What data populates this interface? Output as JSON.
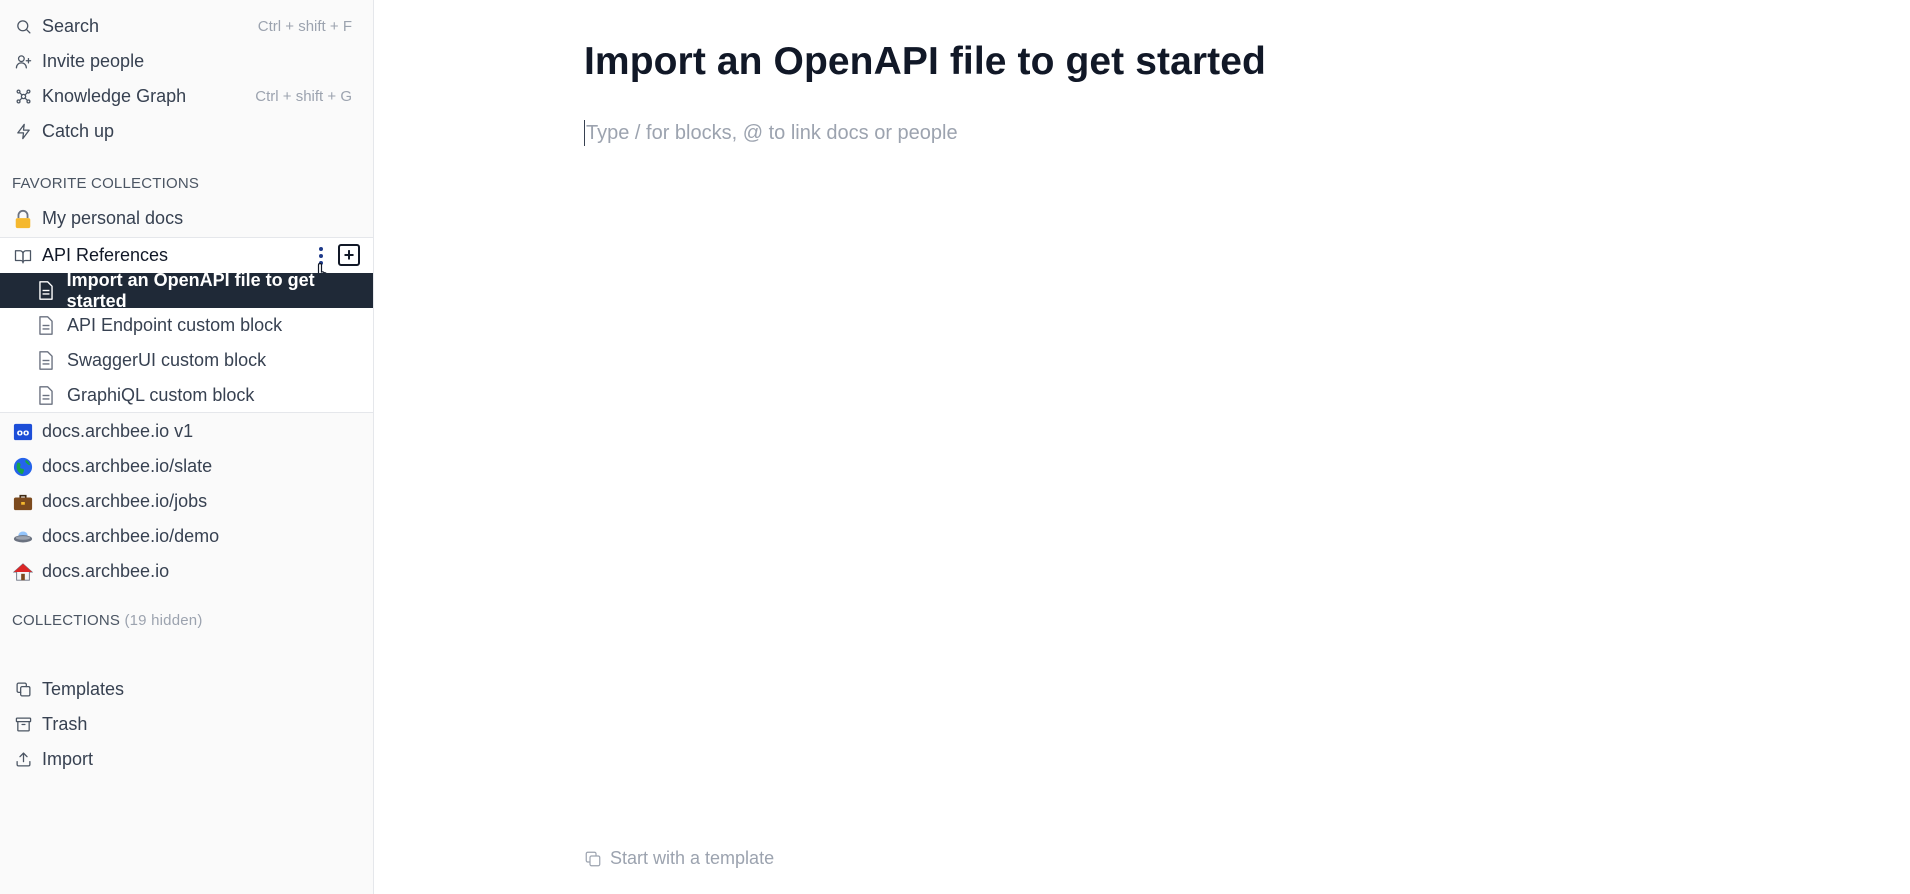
{
  "sidebar": {
    "top_nav": [
      {
        "label": "Search",
        "shortcut": "Ctrl + shift + F",
        "icon": "search-icon"
      },
      {
        "label": "Invite people",
        "shortcut": "",
        "icon": "user-plus-icon"
      },
      {
        "label": "Knowledge Graph",
        "shortcut": "Ctrl + shift + G",
        "icon": "graph-icon"
      },
      {
        "label": "Catch up",
        "shortcut": "",
        "icon": "lightning-icon"
      }
    ],
    "favorites_label": "FAVORITE COLLECTIONS",
    "personal_docs": {
      "label": "My personal docs",
      "icon": "lock-emoji-icon"
    },
    "api_collection": {
      "label": "API References",
      "icon": "open-book-icon",
      "docs": [
        {
          "label": "Import an OpenAPI file to get started",
          "active": true
        },
        {
          "label": "API Endpoint custom block",
          "active": false
        },
        {
          "label": "SwaggerUI custom block",
          "active": false
        },
        {
          "label": "GraphiQL custom block",
          "active": false
        }
      ]
    },
    "favorite_collections": [
      {
        "label": "docs.archbee.io v1",
        "icon": "ooo-emoji-icon"
      },
      {
        "label": "docs.archbee.io/slate",
        "icon": "globe-emoji-icon"
      },
      {
        "label": "docs.archbee.io/jobs",
        "icon": "briefcase-emoji-icon"
      },
      {
        "label": "docs.archbee.io/demo",
        "icon": "ufo-emoji-icon"
      },
      {
        "label": "docs.archbee.io",
        "icon": "house-emoji-icon"
      }
    ],
    "collections_label": "COLLECTIONS",
    "collections_hidden": "(19 hidden)",
    "bottom_nav": [
      {
        "label": "Templates",
        "icon": "copy-icon"
      },
      {
        "label": "Trash",
        "icon": "archive-icon"
      },
      {
        "label": "Import",
        "icon": "upload-icon"
      }
    ]
  },
  "main": {
    "title": "Import an OpenAPI file to get started",
    "placeholder": "Type / for blocks, @ to link docs or people",
    "template_link": "Start with a template"
  },
  "colors": {
    "active_bg": "#1f2937",
    "sidebar_bg": "#fafafa",
    "muted_text": "#9ca3af"
  }
}
